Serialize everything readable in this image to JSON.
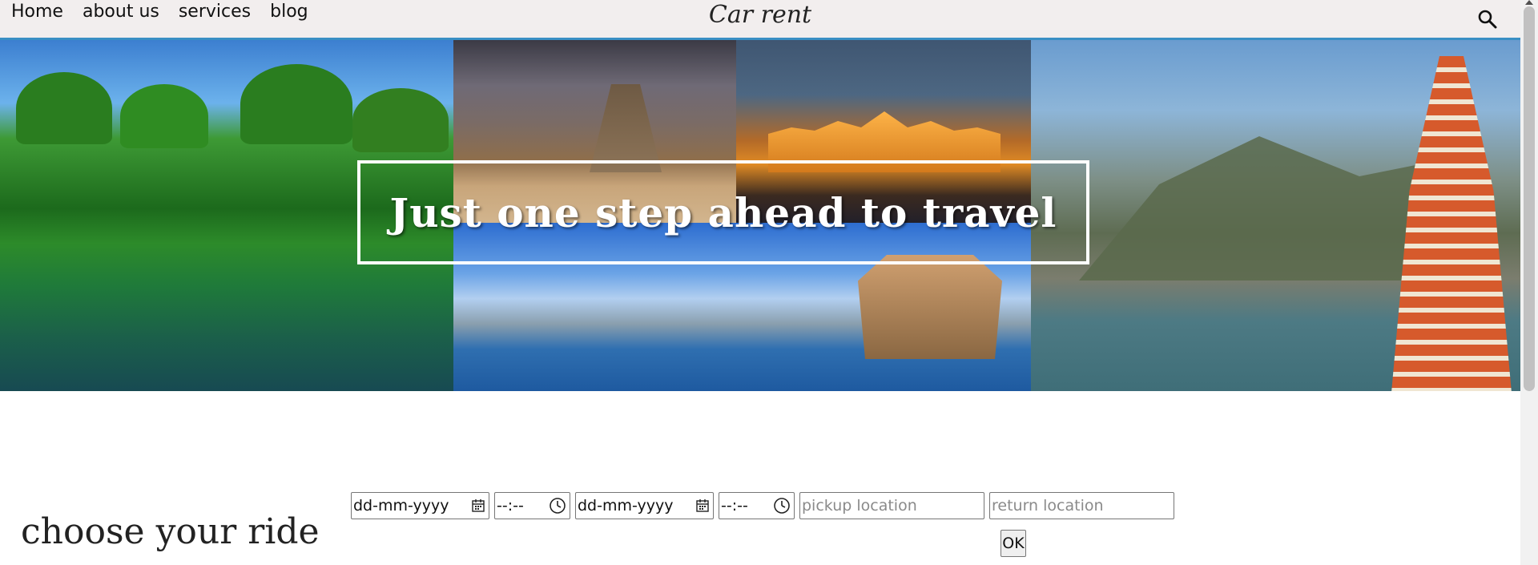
{
  "nav": {
    "links": [
      "Home",
      "about us",
      "services",
      "blog"
    ],
    "brand": "Car rent",
    "search_icon": "search-icon"
  },
  "hero": {
    "headline": "Just one step ahead to travel"
  },
  "booking": {
    "pickup_date_placeholder": "dd-mm-yyyy",
    "pickup_time_placeholder": "--:--",
    "return_date_placeholder": "dd-mm-yyyy",
    "return_time_placeholder": "--:--",
    "pickup_location_placeholder": "pickup location",
    "return_location_placeholder": "return location",
    "ok_label": "OK"
  },
  "section": {
    "title": "choose your ride"
  },
  "colors": {
    "nav_bg": "#f2eeee",
    "nav_border": "#3a8fc4",
    "headline_text": "#ffffff"
  }
}
